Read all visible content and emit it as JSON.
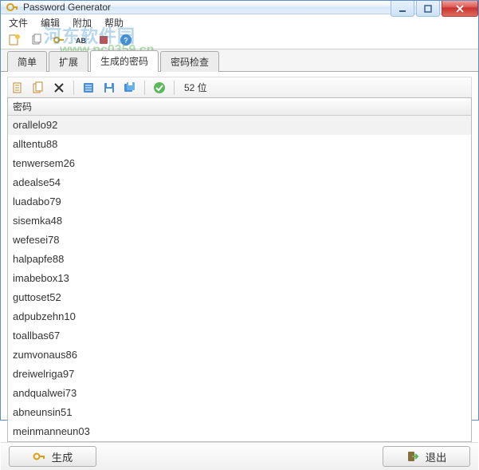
{
  "window": {
    "title": "Password Generator"
  },
  "menu": {
    "file": "文件",
    "edit": "编辑",
    "append": "附加",
    "help": "帮助"
  },
  "watermark": {
    "line1": "河东软件园",
    "line2": "www.pc0359.cn"
  },
  "tabs": {
    "simple": "简单",
    "extended": "扩展",
    "generated": "生成的密码",
    "check": "密码检查"
  },
  "toolbar": {
    "bits_label": "52 位"
  },
  "list": {
    "header": "密码",
    "items": [
      "orallelo92",
      "alltentu88",
      "tenwersem26",
      "adealse54",
      "luadabo79",
      "sisemka48",
      "wefesei78",
      "halpapfe88",
      "imabebox13",
      "guttoset52",
      "adpubzehn10",
      "toallbas67",
      "zumvonaus86",
      "dreiwelriga97",
      "andqualwei73",
      "abneunsin51",
      "meinmanneun03"
    ]
  },
  "footer": {
    "generate": "生成",
    "exit": "退出"
  }
}
